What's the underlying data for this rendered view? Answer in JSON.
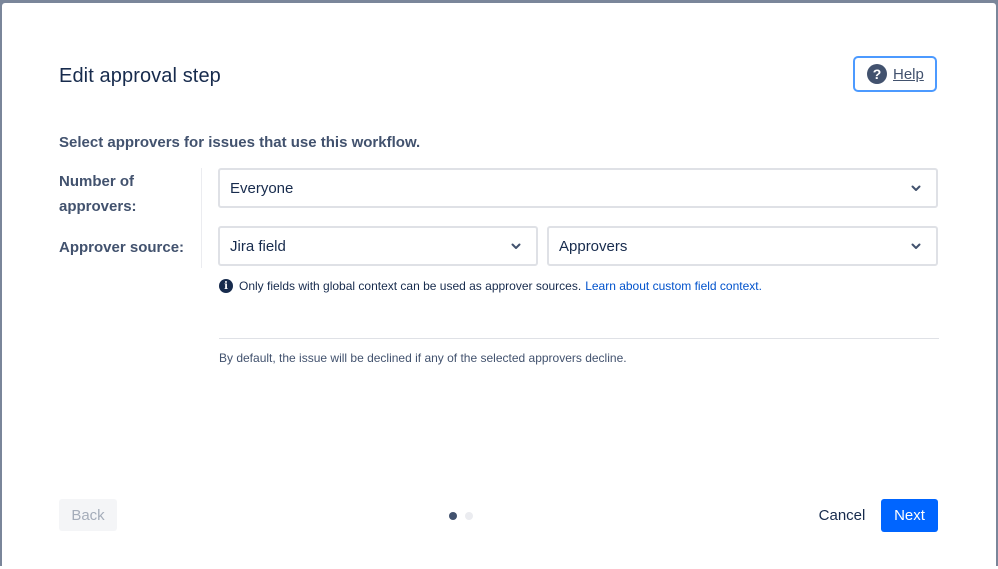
{
  "dialog": {
    "title": "Edit approval step",
    "help_label": "Help",
    "subtitle": "Select approvers for issues that use this workflow."
  },
  "form": {
    "number_label": "Number of approvers:",
    "number_value": "Everyone",
    "source_label": "Approver source:",
    "source_type_value": "Jira field",
    "source_field_value": "Approvers",
    "info_text": "Only fields with global context can be used as approver sources.",
    "info_link": "Learn about custom field context.",
    "note": "By default, the issue will be declined if any of the selected approvers decline."
  },
  "footer": {
    "back_label": "Back",
    "cancel_label": "Cancel",
    "next_label": "Next",
    "steps_total": 2,
    "current_step": 1
  },
  "icons": {
    "help": "question-circle-icon",
    "info": "info-icon",
    "chevron": "chevron-down-icon"
  },
  "colors": {
    "primary": "#0065ff",
    "link": "#0052cc",
    "focus_border": "#4c9aff",
    "text": "#172b4d",
    "subtle_text": "#42526e"
  }
}
